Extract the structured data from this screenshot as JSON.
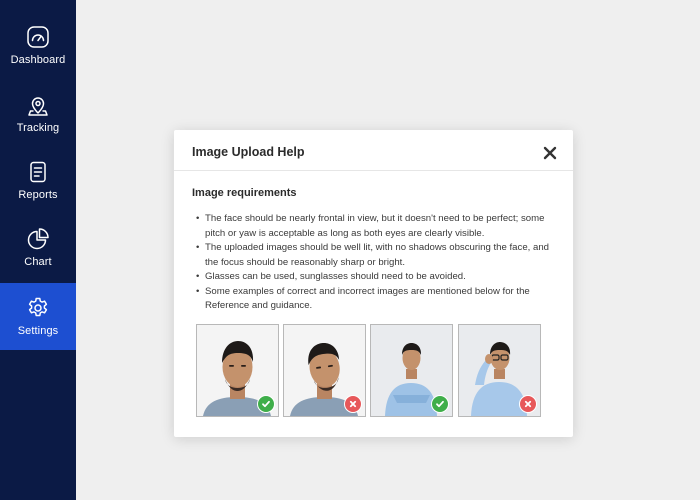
{
  "sidebar": {
    "items": [
      {
        "label": "Dashboard",
        "icon": "dashboard-icon",
        "active": false
      },
      {
        "label": "Tracking",
        "icon": "location-pin-icon",
        "active": false
      },
      {
        "label": "Reports",
        "icon": "report-icon",
        "active": false
      },
      {
        "label": "Chart",
        "icon": "pie-chart-icon",
        "active": false
      },
      {
        "label": "Settings",
        "icon": "gear-icon",
        "active": true
      }
    ],
    "colors": {
      "background": "#0b1a45",
      "active": "#1d4fd1"
    }
  },
  "modal": {
    "title": "Image Upload Help",
    "close_icon": "close-icon",
    "section_title": "Image requirements",
    "requirements": [
      "The face should be nearly frontal in view, but it doesn't need to be perfect; some pitch or yaw is acceptable as long as both eyes are clearly visible.",
      "The uploaded images should be well lit, with no shadows obscuring the face, and the focus should be reasonably sharp or bright.",
      "Glasses can be used, sunglasses should need to be avoided.",
      "Some examples of correct and incorrect images are mentioned below for the Reference and guidance."
    ],
    "examples": [
      {
        "name": "frontal-face-photo",
        "status": "correct",
        "badge_icon": "check-icon"
      },
      {
        "name": "tilted-face-photo",
        "status": "incorrect",
        "badge_icon": "cross-icon"
      },
      {
        "name": "upper-body-photo",
        "status": "correct",
        "badge_icon": "check-icon"
      },
      {
        "name": "hand-on-glasses-photo",
        "status": "incorrect",
        "badge_icon": "cross-icon"
      }
    ],
    "colors": {
      "correct": "#3fae4a",
      "incorrect": "#e7585a"
    }
  }
}
